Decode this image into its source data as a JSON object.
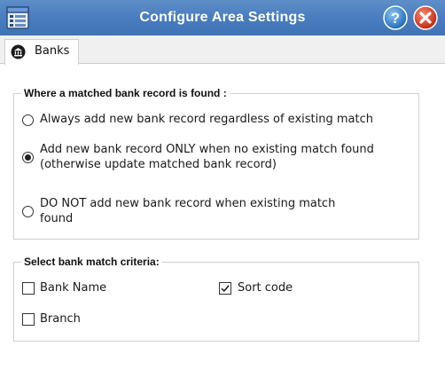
{
  "window": {
    "title": "Configure Area Settings",
    "icons": {
      "app": "window-list-icon",
      "help": "help-icon",
      "close": "close-icon"
    },
    "colors": {
      "titlebar": "#4a7dbf",
      "help": "#2f7fd0",
      "close": "#d9331f"
    }
  },
  "tabs": [
    {
      "label": "Banks",
      "icon": "bank-icon",
      "active": true
    }
  ],
  "match_group": {
    "legend": "Where a matched bank record is found :",
    "options": [
      {
        "line1": "Always add new bank record regardless of existing match",
        "line2": "",
        "selected": false
      },
      {
        "line1": "Add new bank record ONLY when no existing match found",
        "line2": "(otherwise update matched bank record)",
        "selected": true
      },
      {
        "line1": "DO NOT add new bank record when existing match",
        "line2": "found",
        "selected": false
      }
    ]
  },
  "criteria_group": {
    "legend": "Select bank match criteria:",
    "items": [
      {
        "label": "Bank Name",
        "checked": false
      },
      {
        "label": "Sort code",
        "checked": true
      },
      {
        "label": "Branch",
        "checked": false
      }
    ]
  }
}
